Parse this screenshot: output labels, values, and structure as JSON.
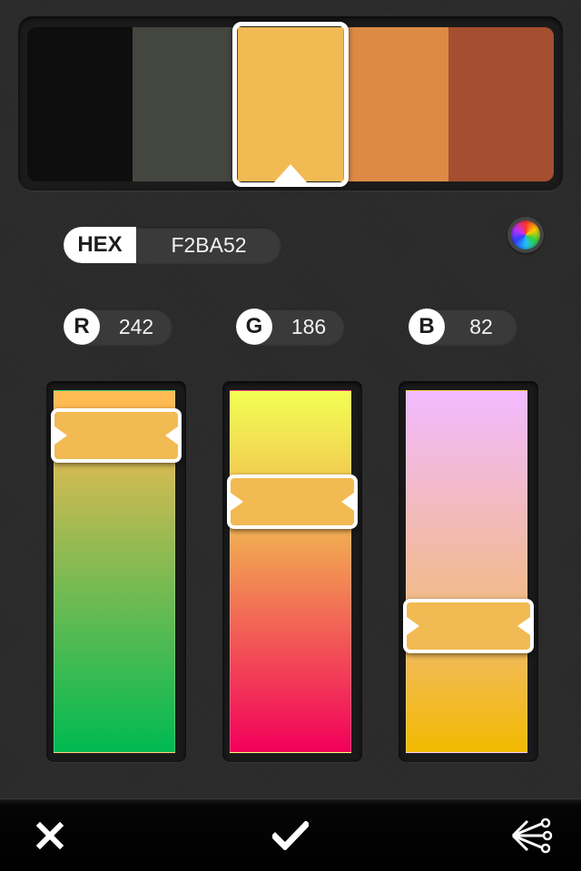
{
  "palette": {
    "swatches": [
      {
        "color": "#0e0e0e"
      },
      {
        "color": "#444640"
      },
      {
        "color": "#f2ba52"
      },
      {
        "color": "#dd8a45"
      },
      {
        "color": "#a44f2f"
      }
    ],
    "selected_index": 2
  },
  "hex": {
    "label": "HEX",
    "value": "F2BA52"
  },
  "channels": {
    "r": {
      "label": "R",
      "value": "242",
      "max": 255
    },
    "g": {
      "label": "G",
      "value": "186",
      "max": 255
    },
    "b": {
      "label": "B",
      "value": "82",
      "max": 255
    }
  },
  "colors": {
    "selected": "#f2ba52",
    "background": "#2b2b2b",
    "toolbar": "#000000"
  },
  "toolbar": {
    "cancel_icon": "close-icon",
    "confirm_icon": "checkmark-icon",
    "share_icon": "share-icon"
  },
  "color_wheel_icon": "color-wheel-icon"
}
